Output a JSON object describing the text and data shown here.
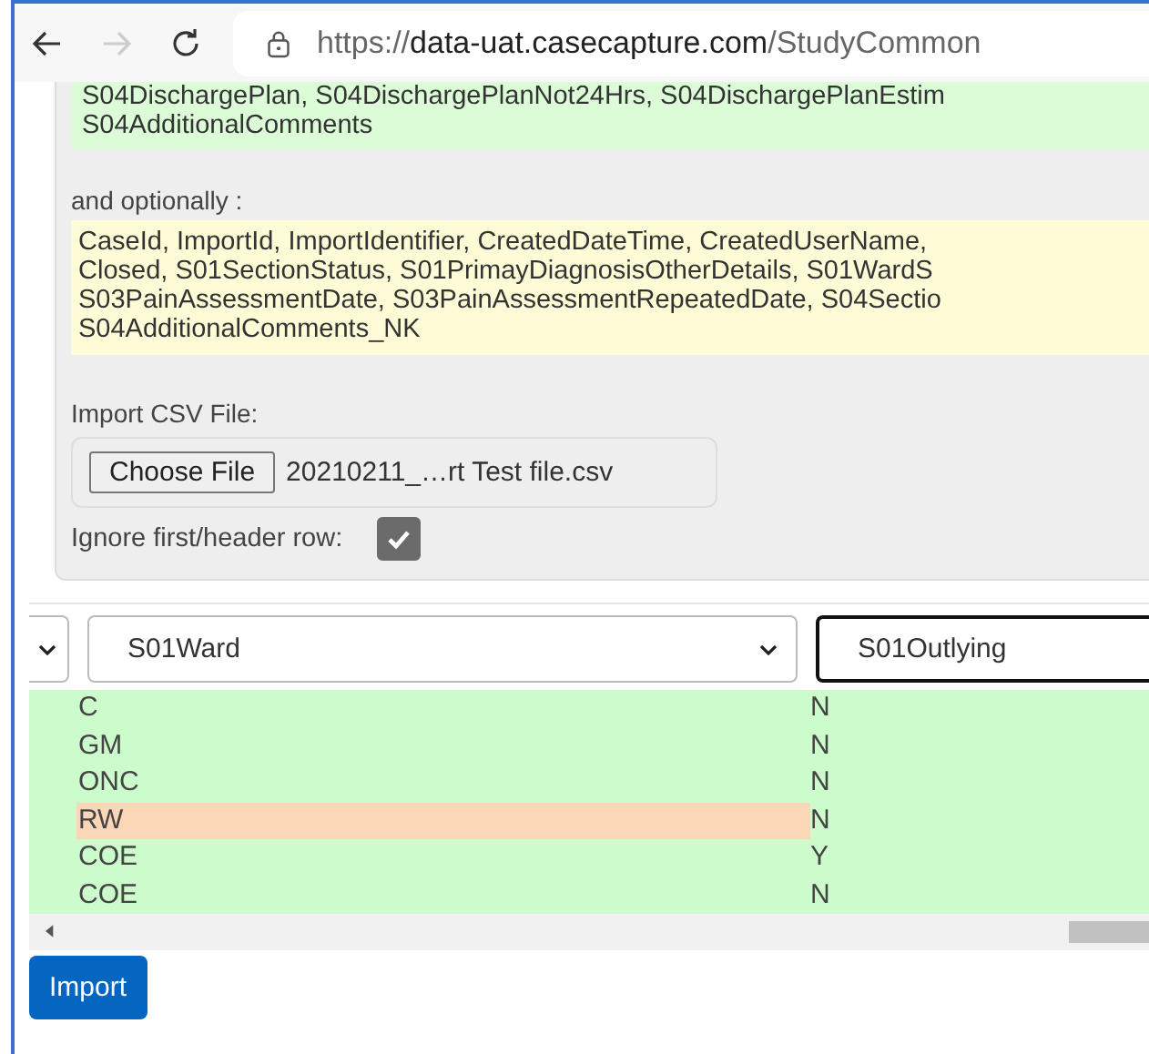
{
  "browser": {
    "url_scheme": "https://",
    "url_host": "data-uat.casecapture.com",
    "url_path": "/StudyCommon",
    "forward_disabled": true
  },
  "required_fields_lines": [
    "S04DischargePlan, S04DischargePlanNot24Hrs, S04DischargePlanEstim",
    "S04AdditionalComments"
  ],
  "optional_label": "and optionally :",
  "optional_fields_lines": [
    "CaseId, ImportId, ImportIdentifier, CreatedDateTime, CreatedUserName,",
    "Closed, S01SectionStatus, S01PrimayDiagnosisOtherDetails, S01WardS",
    "S03PainAssessmentDate, S03PainAssessmentRepeatedDate, S04Sectio",
    "S04AdditionalComments_NK"
  ],
  "import_label": "Import CSV File:",
  "file_button": "Choose File",
  "file_name": "20210211_…rt Test file.csv",
  "ignore_header": {
    "label": "Ignore first/header row:",
    "checked": true
  },
  "columns": [
    {
      "label": "S01Ward",
      "focused": false
    },
    {
      "label": "S01Outlying",
      "focused": true
    }
  ],
  "rows": [
    {
      "ward": "C",
      "outlying": "N",
      "flagged": false
    },
    {
      "ward": "GM",
      "outlying": "N",
      "flagged": false
    },
    {
      "ward": "ONC",
      "outlying": "N",
      "flagged": false
    },
    {
      "ward": "RW",
      "outlying": "N",
      "flagged": true
    },
    {
      "ward": "COE",
      "outlying": "Y",
      "flagged": false
    },
    {
      "ward": "COE",
      "outlying": "N",
      "flagged": false
    }
  ],
  "import_button": "Import"
}
